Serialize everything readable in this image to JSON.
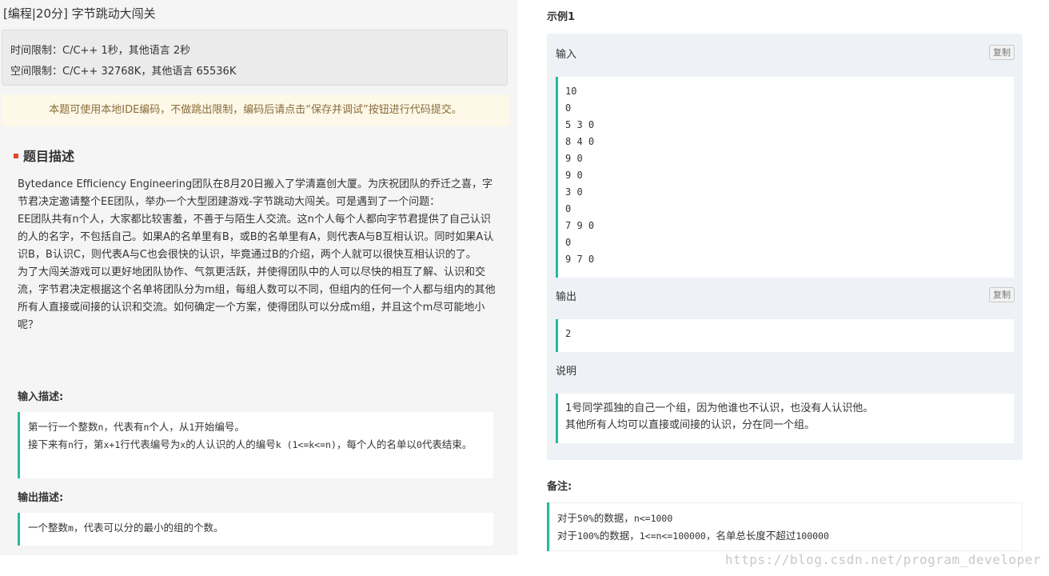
{
  "problem": {
    "title": "[编程|20分] 字节跳动大闯关",
    "time_limit": "时间限制：C/C++ 1秒，其他语言 2秒",
    "memory_limit": "空间限制：C/C++ 32768K，其他语言 65536K",
    "notice": "本题可使用本地IDE编码，不做跳出限制，编码后请点击“保存并调试”按钮进行代码提交。",
    "section_title": "题目描述",
    "description": [
      "Bytedance Efficiency Engineering团队在8月20日搬入了学清嘉创大厦。为庆祝团队的乔迁之喜，字节君决定邀请整个EE团队，举办一个大型团建游戏-字节跳动大闯关。可是遇到了一个问题：",
      "EE团队共有n个人，大家都比较害羞，不善于与陌生人交流。这n个人每个人都向字节君提供了自己认识的人的名字，不包括自己。如果A的名单里有B，或B的名单里有A，则代表A与B互相认识。同时如果A认识B，B认识C，则代表A与C也会很快的认识，毕竟通过B的介绍，两个人就可以很快互相认识的了。",
      "为了大闯关游戏可以更好地团队协作、气氛更活跃，并使得团队中的人可以尽快的相互了解、认识和交流，字节君决定根据这个名单将团队分为m组，每组人数可以不同，但组内的任何一个人都与组内的其他所有人直接或间接的认识和交流。如何确定一个方案，使得团队可以分成m组，并且这个m尽可能地小呢？"
    ],
    "input_heading": "输入描述:",
    "input_line1": {
      "a": "第一行一个整数",
      "b": "n",
      "c": "，代表有",
      "d": "n",
      "e": "个人，从",
      "f": "1",
      "g": "开始编号。"
    },
    "input_line2": {
      "a": "接下来有",
      "b": "n",
      "c": "行，第",
      "d": "x+1",
      "e": "行代表编号为",
      "f": "x",
      "g": "的人认识的人的编号",
      "h": "k (1<=k<=n)",
      "i": "，每个人的名单以",
      "j": "0",
      "k": "代表结束。"
    },
    "output_heading": "输出描述:",
    "output_line": {
      "a": "一个整数",
      "b": "m",
      "c": "，代表可以分的最小的组的个数。"
    }
  },
  "example": {
    "title": "示例1",
    "input_label": "输入",
    "copy_label": "复制",
    "input_lines": [
      "10",
      "0",
      "5 3 0",
      "8 4 0",
      "9 0",
      "9 0",
      "3 0",
      "0",
      "7 9 0",
      "0",
      "9 7 0"
    ],
    "output_label": "输出",
    "output_value": "2",
    "explain_label": "说明",
    "explain_lines": [
      "1号同学孤独的自己一个组，因为他谁也不认识，也没有人认识他。",
      "其他所有人均可以直接或间接的认识，分在同一个组。"
    ]
  },
  "remarks": {
    "title": "备注:",
    "line1": {
      "a": "对于",
      "b": "50%",
      "c": "的数据，",
      "d": "n<=1000"
    },
    "line2": {
      "a": "对于",
      "b": "100%",
      "c": "的数据，",
      "d": "1<=n<=100000",
      "e": "，名单总长度不超过",
      "f": "100000"
    }
  },
  "watermark": "https://blog.csdn.net/program_developer",
  "colors": {
    "accent": "#25bb9b",
    "marker": "#e4452e",
    "notice_bg": "#fdf8e8",
    "notice_text": "#8a6d3b"
  }
}
